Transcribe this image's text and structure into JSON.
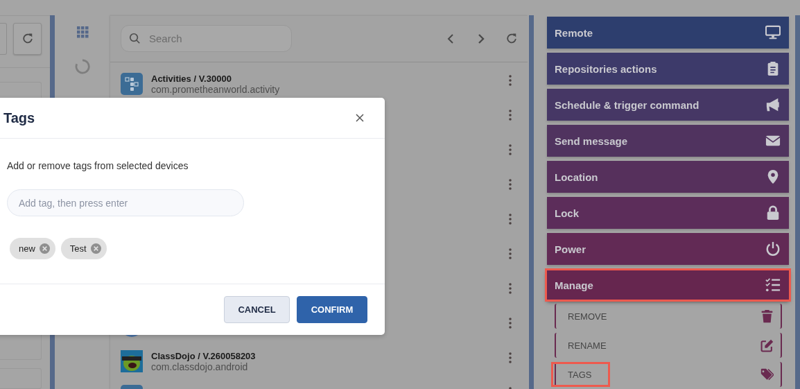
{
  "list_panel": {
    "search": {
      "placeholder": "Search"
    },
    "rows": [
      {
        "kind": "app",
        "title": "Activities / V.30000",
        "subtitle": "com.prometheanworld.activity"
      },
      {
        "kind": "covered"
      },
      {
        "kind": "covered"
      },
      {
        "kind": "covered"
      },
      {
        "kind": "covered"
      },
      {
        "kind": "covered"
      },
      {
        "kind": "covered"
      },
      {
        "kind": "covered"
      },
      {
        "kind": "app",
        "title": "ClassDojo / V.260058203",
        "subtitle": "com.classdojo.android"
      },
      {
        "kind": "covered"
      }
    ]
  },
  "actions": [
    {
      "label": "Remote",
      "color": "#2d3e6e",
      "highlighted": false
    },
    {
      "label": "Repositories actions",
      "color": "#3d3a6a",
      "highlighted": false
    },
    {
      "label": "Schedule & trigger command",
      "color": "#463765",
      "highlighted": false
    },
    {
      "label": "Send message",
      "color": "#50335f",
      "highlighted": false
    },
    {
      "label": "Location",
      "color": "#56305c",
      "highlighted": false
    },
    {
      "label": "Lock",
      "color": "#5c2d5a",
      "highlighted": false
    },
    {
      "label": "Power",
      "color": "#622a55",
      "highlighted": false
    },
    {
      "label": "Manage",
      "color": "#66264f",
      "highlighted": true
    }
  ],
  "sub_actions": [
    {
      "label": "REMOVE",
      "highlighted": false
    },
    {
      "label": "RENAME",
      "highlighted": false
    },
    {
      "label": "TAGS",
      "highlighted": true
    }
  ],
  "modal": {
    "title": "Tags",
    "description": "Add or remove tags from selected devices",
    "tag_input": {
      "placeholder": "Add tag, then press enter"
    },
    "tags": [
      {
        "label": "new"
      },
      {
        "label": "Test"
      }
    ],
    "buttons": [
      {
        "label": "CANCEL",
        "kind": "secondary"
      },
      {
        "label": "CONFIRM",
        "kind": "primary"
      }
    ]
  }
}
